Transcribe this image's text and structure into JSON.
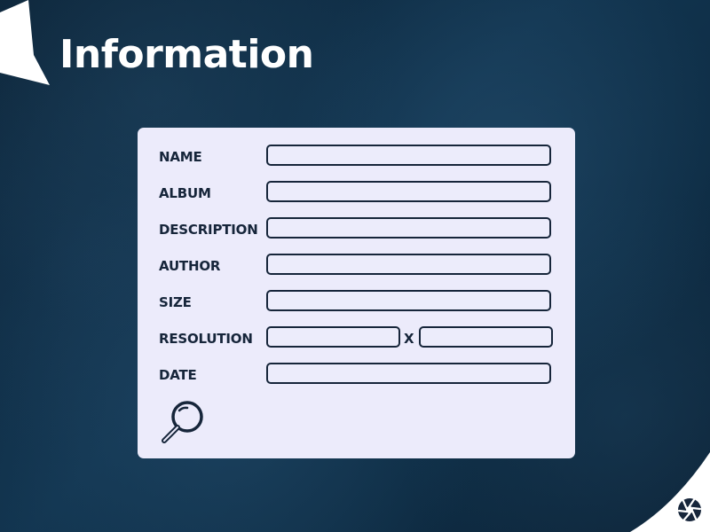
{
  "header": {
    "title": "Information"
  },
  "form": {
    "fields": [
      {
        "label": "NAME",
        "value": ""
      },
      {
        "label": "ALBUM",
        "value": ""
      },
      {
        "label": "DESCRIPTION",
        "value": ""
      },
      {
        "label": "AUTHOR",
        "value": ""
      },
      {
        "label": "SIZE",
        "value": ""
      },
      {
        "label": "RESOLUTION",
        "width_value": "",
        "height_value": "",
        "separator": "X"
      },
      {
        "label": "DATE",
        "value": ""
      }
    ]
  },
  "icons": {
    "search": "search-icon",
    "shutter": "camera-shutter-icon",
    "flag": "flag-banner-icon"
  },
  "colors": {
    "background": "#0e2d45",
    "panel": "#ecebfb",
    "ink": "#16253a",
    "title": "#ffffff"
  }
}
